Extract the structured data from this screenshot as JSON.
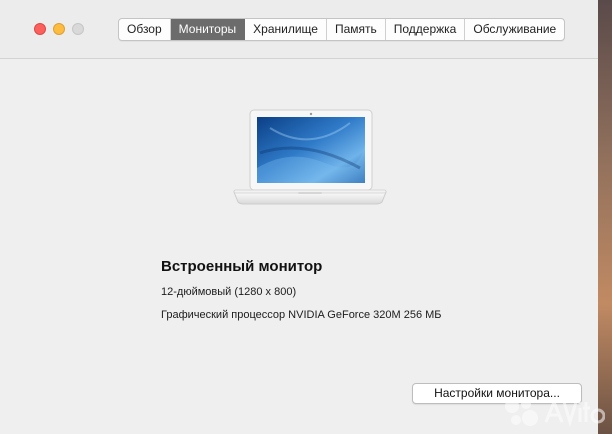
{
  "window": {
    "traffic_lights": {
      "close_color": "#fc605c",
      "minimize_color": "#fdbc40",
      "maximize_color": "#d9d9d9"
    }
  },
  "tabs": [
    {
      "label": "Обзор",
      "active": false
    },
    {
      "label": "Мониторы",
      "active": true
    },
    {
      "label": "Хранилище",
      "active": false
    },
    {
      "label": "Память",
      "active": false
    },
    {
      "label": "Поддержка",
      "active": false
    },
    {
      "label": "Обслуживание",
      "active": false
    }
  ],
  "display": {
    "image_icon": "white-macbook-icon",
    "title": "Встроенный монитор",
    "size": "12-дюймовый (1280 x 800)",
    "gpu": "Графический процессор NVIDIA GeForce 320M 256 МБ"
  },
  "actions": {
    "settings_button": "Настройки монитора..."
  },
  "colors": {
    "active_tab_bg": "#6c6c6c",
    "window_bg": "#ececec"
  }
}
